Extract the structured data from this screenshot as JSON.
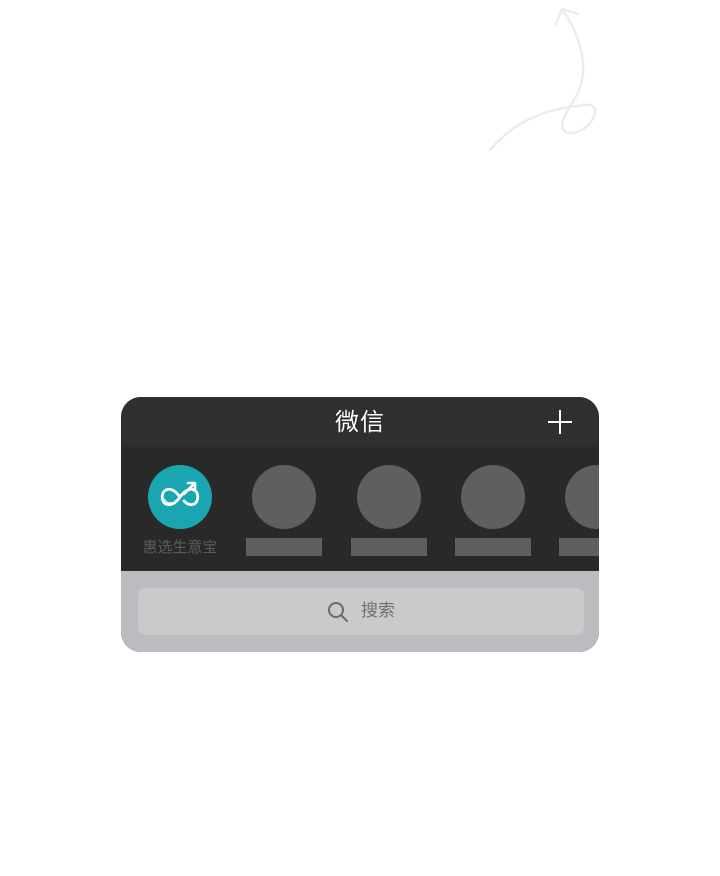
{
  "header": {
    "title": "微信",
    "add_icon": "plus-icon"
  },
  "apps": [
    {
      "label": "惠选生意宝",
      "icon": "infinity-arrow-logo",
      "color": "#1aa6b0"
    },
    {
      "label": "",
      "icon": "placeholder-avatar",
      "color": "#5f5f5f"
    },
    {
      "label": "",
      "icon": "placeholder-avatar",
      "color": "#5f5f5f"
    },
    {
      "label": "",
      "icon": "placeholder-avatar",
      "color": "#5f5f5f"
    },
    {
      "label": "",
      "icon": "placeholder-avatar",
      "color": "#5f5f5f"
    }
  ],
  "search": {
    "placeholder": "搜索",
    "icon": "search-icon"
  },
  "colors": {
    "panel_dark": "#2b2b2b",
    "brand_teal": "#1aa6b0",
    "search_bg": "#bcbcc0"
  }
}
